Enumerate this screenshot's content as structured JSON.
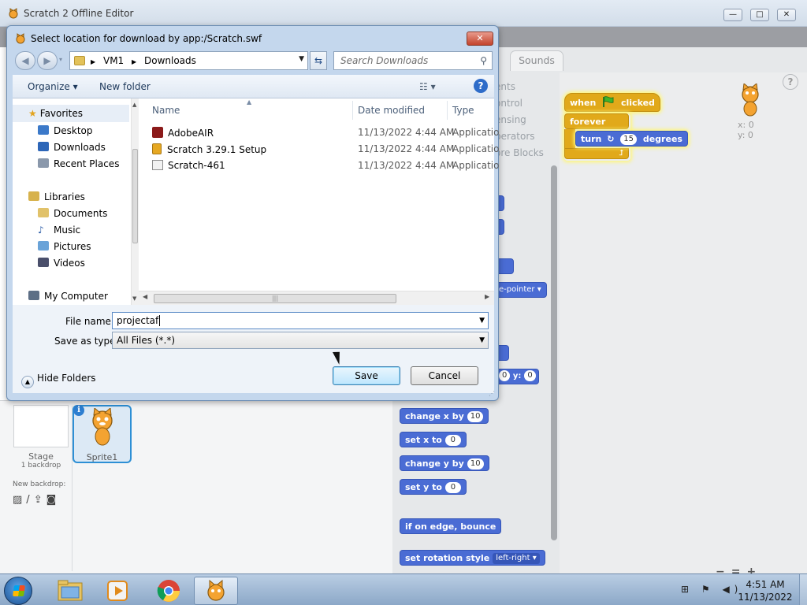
{
  "app": {
    "title": "Scratch 2 Offline Editor",
    "window_controls": {
      "minimize": "—",
      "maximize": "□",
      "close": "✕"
    },
    "tabs": {
      "sounds": "Sounds"
    },
    "palette_categories": [
      "ents",
      "ontrol",
      "ensing",
      "perators",
      "ore Blocks"
    ],
    "script": {
      "hat_when": "when",
      "hat_clicked": "clicked",
      "forever": "forever",
      "turn_label": "turn",
      "turn_value": "15",
      "turn_unit": "degrees"
    },
    "partial_blocks": {
      "rotation_drop": "e-pointer",
      "goto_y_label": "y:",
      "goto_x_value": "0",
      "goto_y_value": "0"
    },
    "blocks": [
      {
        "label": "change x by",
        "value": "10"
      },
      {
        "label": "set x to",
        "value": "0"
      },
      {
        "label": "change y by",
        "value": "10"
      },
      {
        "label": "set y to",
        "value": "0"
      }
    ],
    "bounce_block": "if on edge, bounce",
    "rotation_block": {
      "label": "set rotation style",
      "value": "left-right"
    },
    "sprite_xy": {
      "x_label": "x: 0",
      "y_label": "y: 0"
    },
    "help": "?",
    "stage": {
      "label": "Stage",
      "sub": "1 backdrop"
    },
    "new_backdrop": "New backdrop:",
    "sprite": {
      "name": "Sprite1",
      "info": "i"
    },
    "zoom": "−=+"
  },
  "dialog": {
    "title": "Select location for download by app:/Scratch.swf",
    "close": "✕",
    "address": {
      "part1": "VM1",
      "sep": "▶",
      "part2": "Downloads"
    },
    "search_placeholder": "Search Downloads",
    "toolbar": {
      "organize": "Organize ▾",
      "new_folder": "New folder",
      "views": "☷ ▾",
      "help": "?"
    },
    "nav": {
      "favorites": "Favorites",
      "desktop": "Desktop",
      "downloads": "Downloads",
      "recent": "Recent Places",
      "libraries": "Libraries",
      "documents": "Documents",
      "music": "Music",
      "pictures": "Pictures",
      "videos": "Videos",
      "computer": "My Computer"
    },
    "columns": {
      "name": "Name",
      "date": "Date modified",
      "type": "Type"
    },
    "files": [
      {
        "name": "AdobeAIR",
        "date": "11/13/2022 4:44 AM",
        "type": "Applicatio"
      },
      {
        "name": "Scratch 3.29.1 Setup",
        "date": "11/13/2022 4:44 AM",
        "type": "Applicatio"
      },
      {
        "name": "Scratch-461",
        "date": "11/13/2022 4:44 AM",
        "type": "Applicatio"
      }
    ],
    "file_name_label": "File name:",
    "file_name_value": "projectaf",
    "save_type_label": "Save as type:",
    "save_type_value": "All Files (*.*)",
    "save": "Save",
    "cancel": "Cancel",
    "hide_folders": "Hide Folders"
  },
  "taskbar": {
    "time": "4:51 AM",
    "date": "11/13/2022",
    "tray": "⊞ ⚑ ◀)"
  },
  "colors": {
    "motion": "#4a6cd4",
    "control": "#e1a91a",
    "selection": "#2d8fd5"
  }
}
